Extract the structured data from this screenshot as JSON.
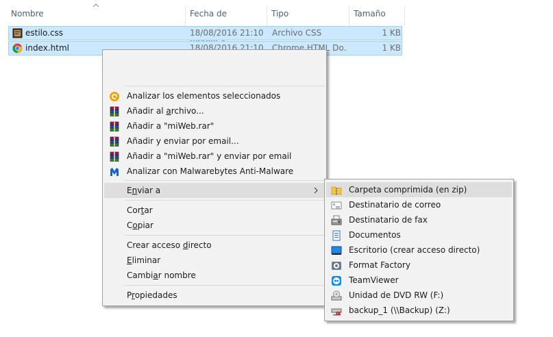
{
  "columns": {
    "name": "Nombre",
    "date": "Fecha de modifica...",
    "type": "Tipo",
    "size": "Tamaño"
  },
  "files": [
    {
      "name": "estilo.css",
      "date": "18/08/2016 21:10",
      "type": "Archivo CSS",
      "size": "1 KB",
      "icon": "css-file-icon"
    },
    {
      "name": "index.html",
      "date": "18/08/2016 21:10",
      "type": "Chrome HTML Do...",
      "size": "1 KB",
      "icon": "chrome-icon"
    }
  ],
  "context_menu": {
    "items": [
      {
        "label_pre": "Analizar los elementos seleccionados",
        "u": "",
        "label_post": "",
        "icon": "scan-icon"
      },
      {
        "label_pre": "Añadir al ",
        "u": "a",
        "label_post": "rchivo...",
        "icon": "winrar-icon"
      },
      {
        "label_pre": "Añadir a \"miWeb.rar\"",
        "u": "",
        "label_post": "",
        "icon": "winrar-icon"
      },
      {
        "label_pre": "Añadir y enviar por email...",
        "u": "",
        "label_post": "",
        "icon": "winrar-icon"
      },
      {
        "label_pre": "Añadir a \"miWeb.rar\" y enviar por email",
        "u": "",
        "label_post": "",
        "icon": "winrar-icon"
      },
      {
        "label_pre": "Analizar con Malwarebytes Anti-Malware",
        "u": "",
        "label_post": "",
        "icon": "malwarebytes-icon"
      },
      {
        "label_pre": "E",
        "u": "n",
        "label_post": "viar a",
        "icon": ""
      },
      {
        "label_pre": "Cor",
        "u": "t",
        "label_post": "ar",
        "icon": ""
      },
      {
        "label_pre": "C",
        "u": "o",
        "label_post": "piar",
        "icon": ""
      },
      {
        "label_pre": "Crear acceso ",
        "u": "d",
        "label_post": "irecto",
        "icon": ""
      },
      {
        "label_pre": "",
        "u": "E",
        "label_post": "liminar",
        "icon": ""
      },
      {
        "label_pre": "Cambi",
        "u": "a",
        "label_post": "r nombre",
        "icon": ""
      },
      {
        "label_pre": "P",
        "u": "r",
        "label_post": "opiedades",
        "icon": ""
      }
    ]
  },
  "send_to_menu": {
    "items": [
      {
        "label": "Carpeta comprimida (en zip)",
        "icon": "zip-folder-icon"
      },
      {
        "label": "Destinatario de correo",
        "icon": "mail-recipient-icon"
      },
      {
        "label": "Destinatario de fax",
        "icon": "fax-icon"
      },
      {
        "label": "Documentos",
        "icon": "documents-icon"
      },
      {
        "label": "Escritorio (crear acceso directo)",
        "icon": "desktop-icon"
      },
      {
        "label": "Format Factory",
        "icon": "format-factory-icon"
      },
      {
        "label": "TeamViewer",
        "icon": "teamviewer-icon"
      },
      {
        "label": "Unidad de DVD RW (F:)",
        "icon": "dvd-drive-icon"
      },
      {
        "label": "backup_1 (\\\\Backup) (Z:)",
        "icon": "network-drive-icon"
      }
    ]
  },
  "colors": {
    "selection_bg": "#cce8ff",
    "selection_border": "#99d1ff",
    "menu_bg": "#f2f2f2",
    "menu_highlight": "#dedede",
    "header_text": "#4c607a"
  }
}
